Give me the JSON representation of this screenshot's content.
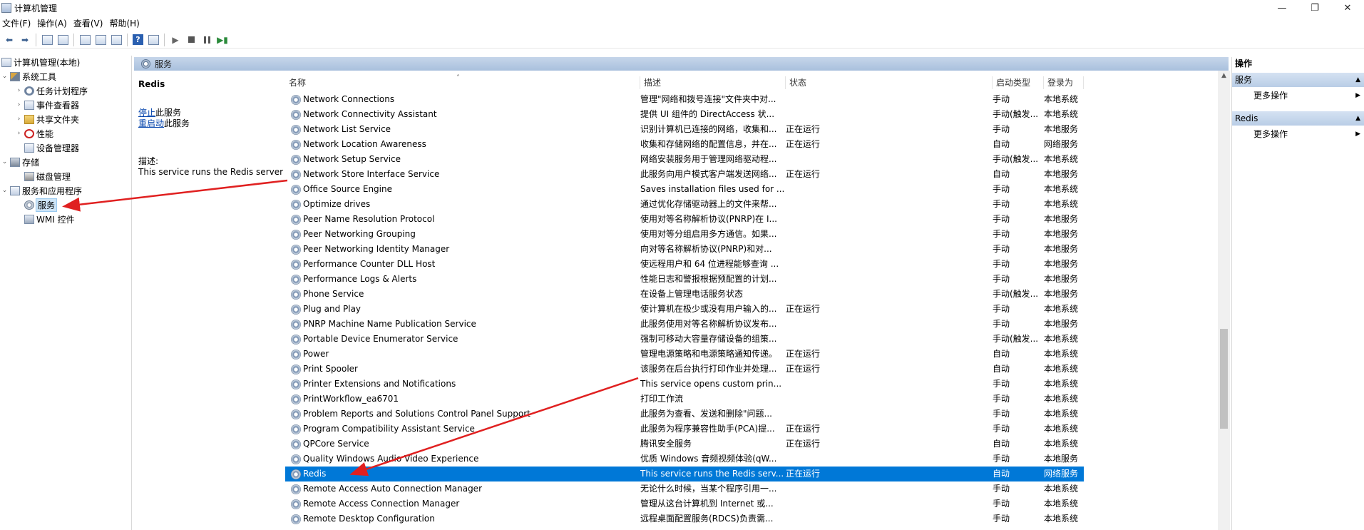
{
  "window": {
    "title": "计算机管理",
    "minimize": "—",
    "maximize": "❐",
    "close": "✕"
  },
  "menu": [
    "文件(F)",
    "操作(A)",
    "查看(V)",
    "帮助(H)"
  ],
  "tree": {
    "root": "计算机管理(本地)",
    "system_tools": "系统工具",
    "task_scheduler": "任务计划程序",
    "event_viewer": "事件查看器",
    "shared_folders": "共享文件夹",
    "performance": "性能",
    "device_manager": "设备管理器",
    "storage": "存储",
    "disk_management": "磁盘管理",
    "services_apps": "服务和应用程序",
    "services": "服务",
    "wmi": "WMI 控件"
  },
  "panel": {
    "title": "服务"
  },
  "detail": {
    "service_name": "Redis",
    "stop_link": "停止",
    "stop_rest": "此服务",
    "restart_link": "重启动",
    "restart_rest": "此服务",
    "desc_label": "描述:",
    "desc_text": "This service runs the Redis server"
  },
  "columns": {
    "name": "名称",
    "desc": "描述",
    "status": "状态",
    "start": "启动类型",
    "logon": "登录为"
  },
  "rows": [
    {
      "name": "Network Connections",
      "desc": "管理\"网络和拨号连接\"文件夹中对...",
      "status": "",
      "start": "手动",
      "logon": "本地系统"
    },
    {
      "name": "Network Connectivity Assistant",
      "desc": "提供 UI 组件的 DirectAccess 状...",
      "status": "",
      "start": "手动(触发...",
      "logon": "本地系统"
    },
    {
      "name": "Network List Service",
      "desc": "识别计算机已连接的网络，收集和...",
      "status": "正在运行",
      "start": "手动",
      "logon": "本地服务"
    },
    {
      "name": "Network Location Awareness",
      "desc": "收集和存储网络的配置信息，并在...",
      "status": "正在运行",
      "start": "自动",
      "logon": "网络服务"
    },
    {
      "name": "Network Setup Service",
      "desc": "网络安装服务用于管理网络驱动程...",
      "status": "",
      "start": "手动(触发...",
      "logon": "本地系统"
    },
    {
      "name": "Network Store Interface Service",
      "desc": "此服务向用户模式客户端发送网络...",
      "status": "正在运行",
      "start": "自动",
      "logon": "本地服务"
    },
    {
      "name": "Office  Source Engine",
      "desc": "Saves installation files used for ...",
      "status": "",
      "start": "手动",
      "logon": "本地系统"
    },
    {
      "name": "Optimize drives",
      "desc": "通过优化存储驱动器上的文件来帮...",
      "status": "",
      "start": "手动",
      "logon": "本地系统"
    },
    {
      "name": "Peer Name Resolution Protocol",
      "desc": "使用对等名称解析协议(PNRP)在 I...",
      "status": "",
      "start": "手动",
      "logon": "本地服务"
    },
    {
      "name": "Peer Networking Grouping",
      "desc": "使用对等分组启用多方通信。如果...",
      "status": "",
      "start": "手动",
      "logon": "本地服务"
    },
    {
      "name": "Peer Networking Identity Manager",
      "desc": "向对等名称解析协议(PNRP)和对...",
      "status": "",
      "start": "手动",
      "logon": "本地服务"
    },
    {
      "name": "Performance Counter DLL Host",
      "desc": "使远程用户和 64 位进程能够查询 ...",
      "status": "",
      "start": "手动",
      "logon": "本地服务"
    },
    {
      "name": "Performance Logs & Alerts",
      "desc": "性能日志和警报根据预配置的计划...",
      "status": "",
      "start": "手动",
      "logon": "本地服务"
    },
    {
      "name": "Phone Service",
      "desc": "在设备上管理电话服务状态",
      "status": "",
      "start": "手动(触发...",
      "logon": "本地服务"
    },
    {
      "name": "Plug and Play",
      "desc": "使计算机在极少或没有用户输入的...",
      "status": "正在运行",
      "start": "手动",
      "logon": "本地系统"
    },
    {
      "name": "PNRP Machine Name Publication Service",
      "desc": "此服务使用对等名称解析协议发布...",
      "status": "",
      "start": "手动",
      "logon": "本地服务"
    },
    {
      "name": "Portable Device Enumerator Service",
      "desc": "强制可移动大容量存储设备的组策...",
      "status": "",
      "start": "手动(触发...",
      "logon": "本地系统"
    },
    {
      "name": "Power",
      "desc": "管理电源策略和电源策略通知传递。",
      "status": "正在运行",
      "start": "自动",
      "logon": "本地系统"
    },
    {
      "name": "Print Spooler",
      "desc": "该服务在后台执行打印作业并处理...",
      "status": "正在运行",
      "start": "自动",
      "logon": "本地系统"
    },
    {
      "name": "Printer Extensions and Notifications",
      "desc": "This service opens custom prin...",
      "status": "",
      "start": "手动",
      "logon": "本地系统"
    },
    {
      "name": "PrintWorkflow_ea6701",
      "desc": "打印工作流",
      "status": "",
      "start": "手动",
      "logon": "本地系统"
    },
    {
      "name": "Problem Reports and Solutions Control Panel Support",
      "desc": "此服务为查看、发送和删除\"问题...",
      "status": "",
      "start": "手动",
      "logon": "本地系统"
    },
    {
      "name": "Program Compatibility Assistant Service",
      "desc": "此服务为程序兼容性助手(PCA)提...",
      "status": "正在运行",
      "start": "手动",
      "logon": "本地系统"
    },
    {
      "name": "QPCore Service",
      "desc": "腾讯安全服务",
      "status": "正在运行",
      "start": "自动",
      "logon": "本地系统"
    },
    {
      "name": "Quality Windows Audio Video Experience",
      "desc": "优质 Windows 音频视频体验(qW...",
      "status": "",
      "start": "手动",
      "logon": "本地服务"
    },
    {
      "name": "Redis",
      "desc": "This service runs the Redis serv...",
      "status": "正在运行",
      "start": "自动",
      "logon": "网络服务",
      "selected": true
    },
    {
      "name": "Remote Access Auto Connection Manager",
      "desc": "无论什么时候，当某个程序引用一...",
      "status": "",
      "start": "手动",
      "logon": "本地系统"
    },
    {
      "name": "Remote Access Connection Manager",
      "desc": "管理从这台计算机到 Internet 或...",
      "status": "",
      "start": "手动",
      "logon": "本地系统"
    },
    {
      "name": "Remote Desktop Configuration",
      "desc": "远程桌面配置服务(RDCS)负责需...",
      "status": "",
      "start": "手动",
      "logon": "本地系统"
    }
  ],
  "actions": {
    "title": "操作",
    "section1": "服务",
    "section1_item": "更多操作",
    "section2": "Redis",
    "section2_item": "更多操作"
  },
  "colors": {
    "selected_row": "#0078d7",
    "annotation_arrow": "#e02020"
  }
}
